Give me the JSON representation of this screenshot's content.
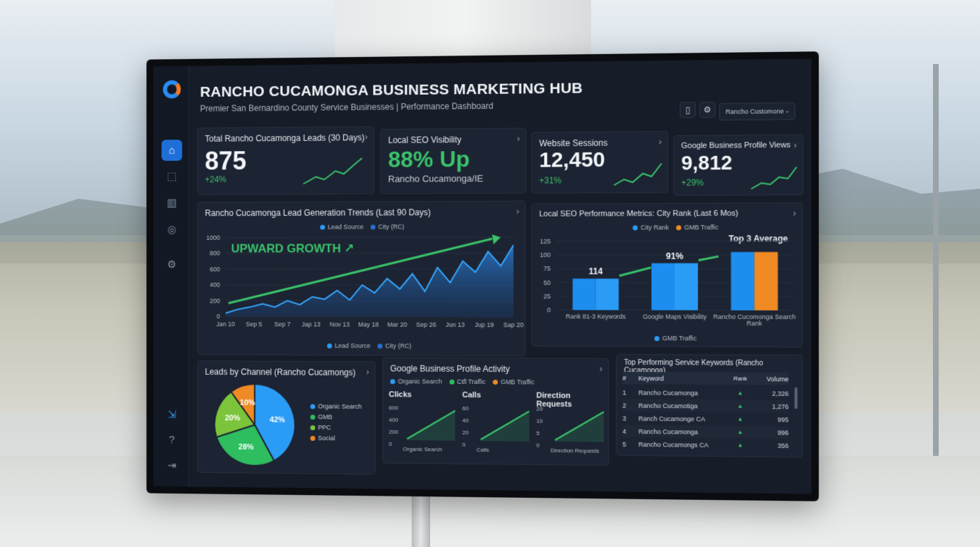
{
  "header": {
    "title": "RANCHO CUCAMONGA BUSINESS MARKETING HUB",
    "subtitle": "Premier San Bernardino County Service Businesses | Performance Dashboard",
    "selector_value": "Rancho Customone"
  },
  "sidebar": {
    "items": [
      {
        "name": "home-icon",
        "glyph": "⌂"
      },
      {
        "name": "trend-chart-icon",
        "glyph": "⬚"
      },
      {
        "name": "bar-chart-icon",
        "glyph": "▥"
      },
      {
        "name": "palette-icon",
        "glyph": "◎"
      },
      {
        "name": "gear-icon",
        "glyph": "⚙"
      }
    ],
    "bottom_items": [
      {
        "name": "export-icon",
        "glyph": "⇲"
      },
      {
        "name": "help-icon",
        "glyph": "?"
      },
      {
        "name": "logout-icon",
        "glyph": "⇥"
      }
    ]
  },
  "kpis": [
    {
      "title": "Total Rancho Cucamonga Leads (30 Days)",
      "value": "875",
      "delta": "+24%"
    },
    {
      "title": "Local SEO Visibility",
      "value": "88% Up",
      "sub": "Rancho Cucamonga/IE"
    },
    {
      "title": "Website Sessions",
      "value": "12,450",
      "delta": "+31%"
    },
    {
      "title": "Google Business Profile Views",
      "value": "9,812",
      "delta": "+29%"
    }
  ],
  "lead_trend": {
    "title": "Rancho Cucamonga Lead Generation Trends (Last 90 Days)",
    "annotation": "UPWARD GROWTH ↗",
    "legend_top": [
      "Lead Source",
      "City (RC)"
    ],
    "legend_bottom": [
      "Lead Source",
      "City (RC)"
    ]
  },
  "seo_rank": {
    "title": "Local SEO Performance Metrics: City Rank (Last 6 Mos)",
    "legend": [
      "City Rank",
      "GMB Traffic"
    ],
    "bottom_legend": "GMB Traffic",
    "annotation": "Top 3 Average"
  },
  "channels": {
    "title": "Leads by Channel (Rancho Cucamongs)",
    "legend": [
      "Organic Search",
      "GMB",
      "PPC",
      "Social"
    ]
  },
  "gbp": {
    "title": "Google Business Profile Activity",
    "legend": [
      "Organic Search",
      "Ctfl Traffic",
      "GMB Traffic"
    ],
    "mini": [
      {
        "label": "Clicks",
        "ticks": [
          "600",
          "400",
          "200",
          "0"
        ],
        "xlabel": "Organic Search"
      },
      {
        "label": "Calls",
        "ticks": [
          "60",
          "40",
          "20",
          "0"
        ],
        "xlabel": "Calls"
      },
      {
        "label": "Direction Requests",
        "ticks": [
          "20",
          "10",
          "5",
          "0"
        ],
        "xlabel": "Direction Requests"
      }
    ]
  },
  "keywords": {
    "title": "Top Performing Service Keywords (Rancho Cucamonga)",
    "headers": [
      "#",
      "Keyword",
      "Rank",
      "Volume"
    ],
    "rows": [
      {
        "n": "1",
        "kw": "Rancho Cucamonga",
        "rank": "▲",
        "vol": "2,326"
      },
      {
        "n": "2",
        "kw": "Rancho Cucamotiga",
        "rank": "▲",
        "vol": "1,276"
      },
      {
        "n": "3",
        "kw": "Ranch Cucamonge CA",
        "rank": "▲",
        "vol": "995"
      },
      {
        "n": "4",
        "kw": "Rancho Cucamonga",
        "rank": "▲",
        "vol": "996"
      },
      {
        "n": "5",
        "kw": "Rancho Cucamongs CA",
        "rank": "▲",
        "vol": "356"
      }
    ]
  },
  "colors": {
    "accent_blue": "#2a9cf5",
    "accent_green": "#39c26a",
    "accent_orange": "#f08a24",
    "bg": "#161c28"
  },
  "chart_data": [
    {
      "type": "area",
      "title": "Rancho Cucamonga Lead Generation Trends (Last 90 Days)",
      "categories": [
        "Jan 10",
        "Sep 5",
        "Sep 7",
        "Jap 13",
        "Nov 13",
        "May 18",
        "Mar 20",
        "Sep 26",
        "Jun 13",
        "Jup 19",
        "Sap 20"
      ],
      "y_ticks": [
        "1000",
        "800",
        "600",
        "400",
        "200",
        "0"
      ],
      "ylim": [
        0,
        1000
      ],
      "series": [
        {
          "name": "Lead Source",
          "values": [
            40,
            90,
            120,
            160,
            120,
            200,
            150,
            250,
            220,
            330,
            210,
            400,
            300,
            480,
            350,
            540,
            320,
            620,
            430,
            700,
            560,
            820,
            640,
            900
          ]
        }
      ]
    },
    {
      "type": "bar",
      "title": "Local SEO Performance Metrics: City Rank (Last 6 Mos)",
      "categories": [
        "Rank 81-3 Keywords",
        "Google Maps Visibility",
        "Rancho Cucomonga Search Rank"
      ],
      "y_ticks": [
        "125",
        "100",
        "75",
        "50",
        "25",
        "0"
      ],
      "ylim": [
        0,
        125
      ],
      "series": [
        {
          "name": "City Rank",
          "values": [
            57,
            85,
            105
          ]
        },
        {
          "name": "GMB Traffic",
          "values": [
            57,
            85,
            105
          ]
        }
      ],
      "data_labels": [
        "114",
        "91%"
      ]
    },
    {
      "type": "pie",
      "title": "Leads by Channel (Rancho Cucamongs)",
      "categories": [
        "Organic Search",
        "GMB",
        "PPC",
        "Social"
      ],
      "values": [
        42,
        28,
        20,
        10
      ],
      "labels": [
        "42%",
        "28%",
        "20%",
        "10%"
      ]
    }
  ]
}
